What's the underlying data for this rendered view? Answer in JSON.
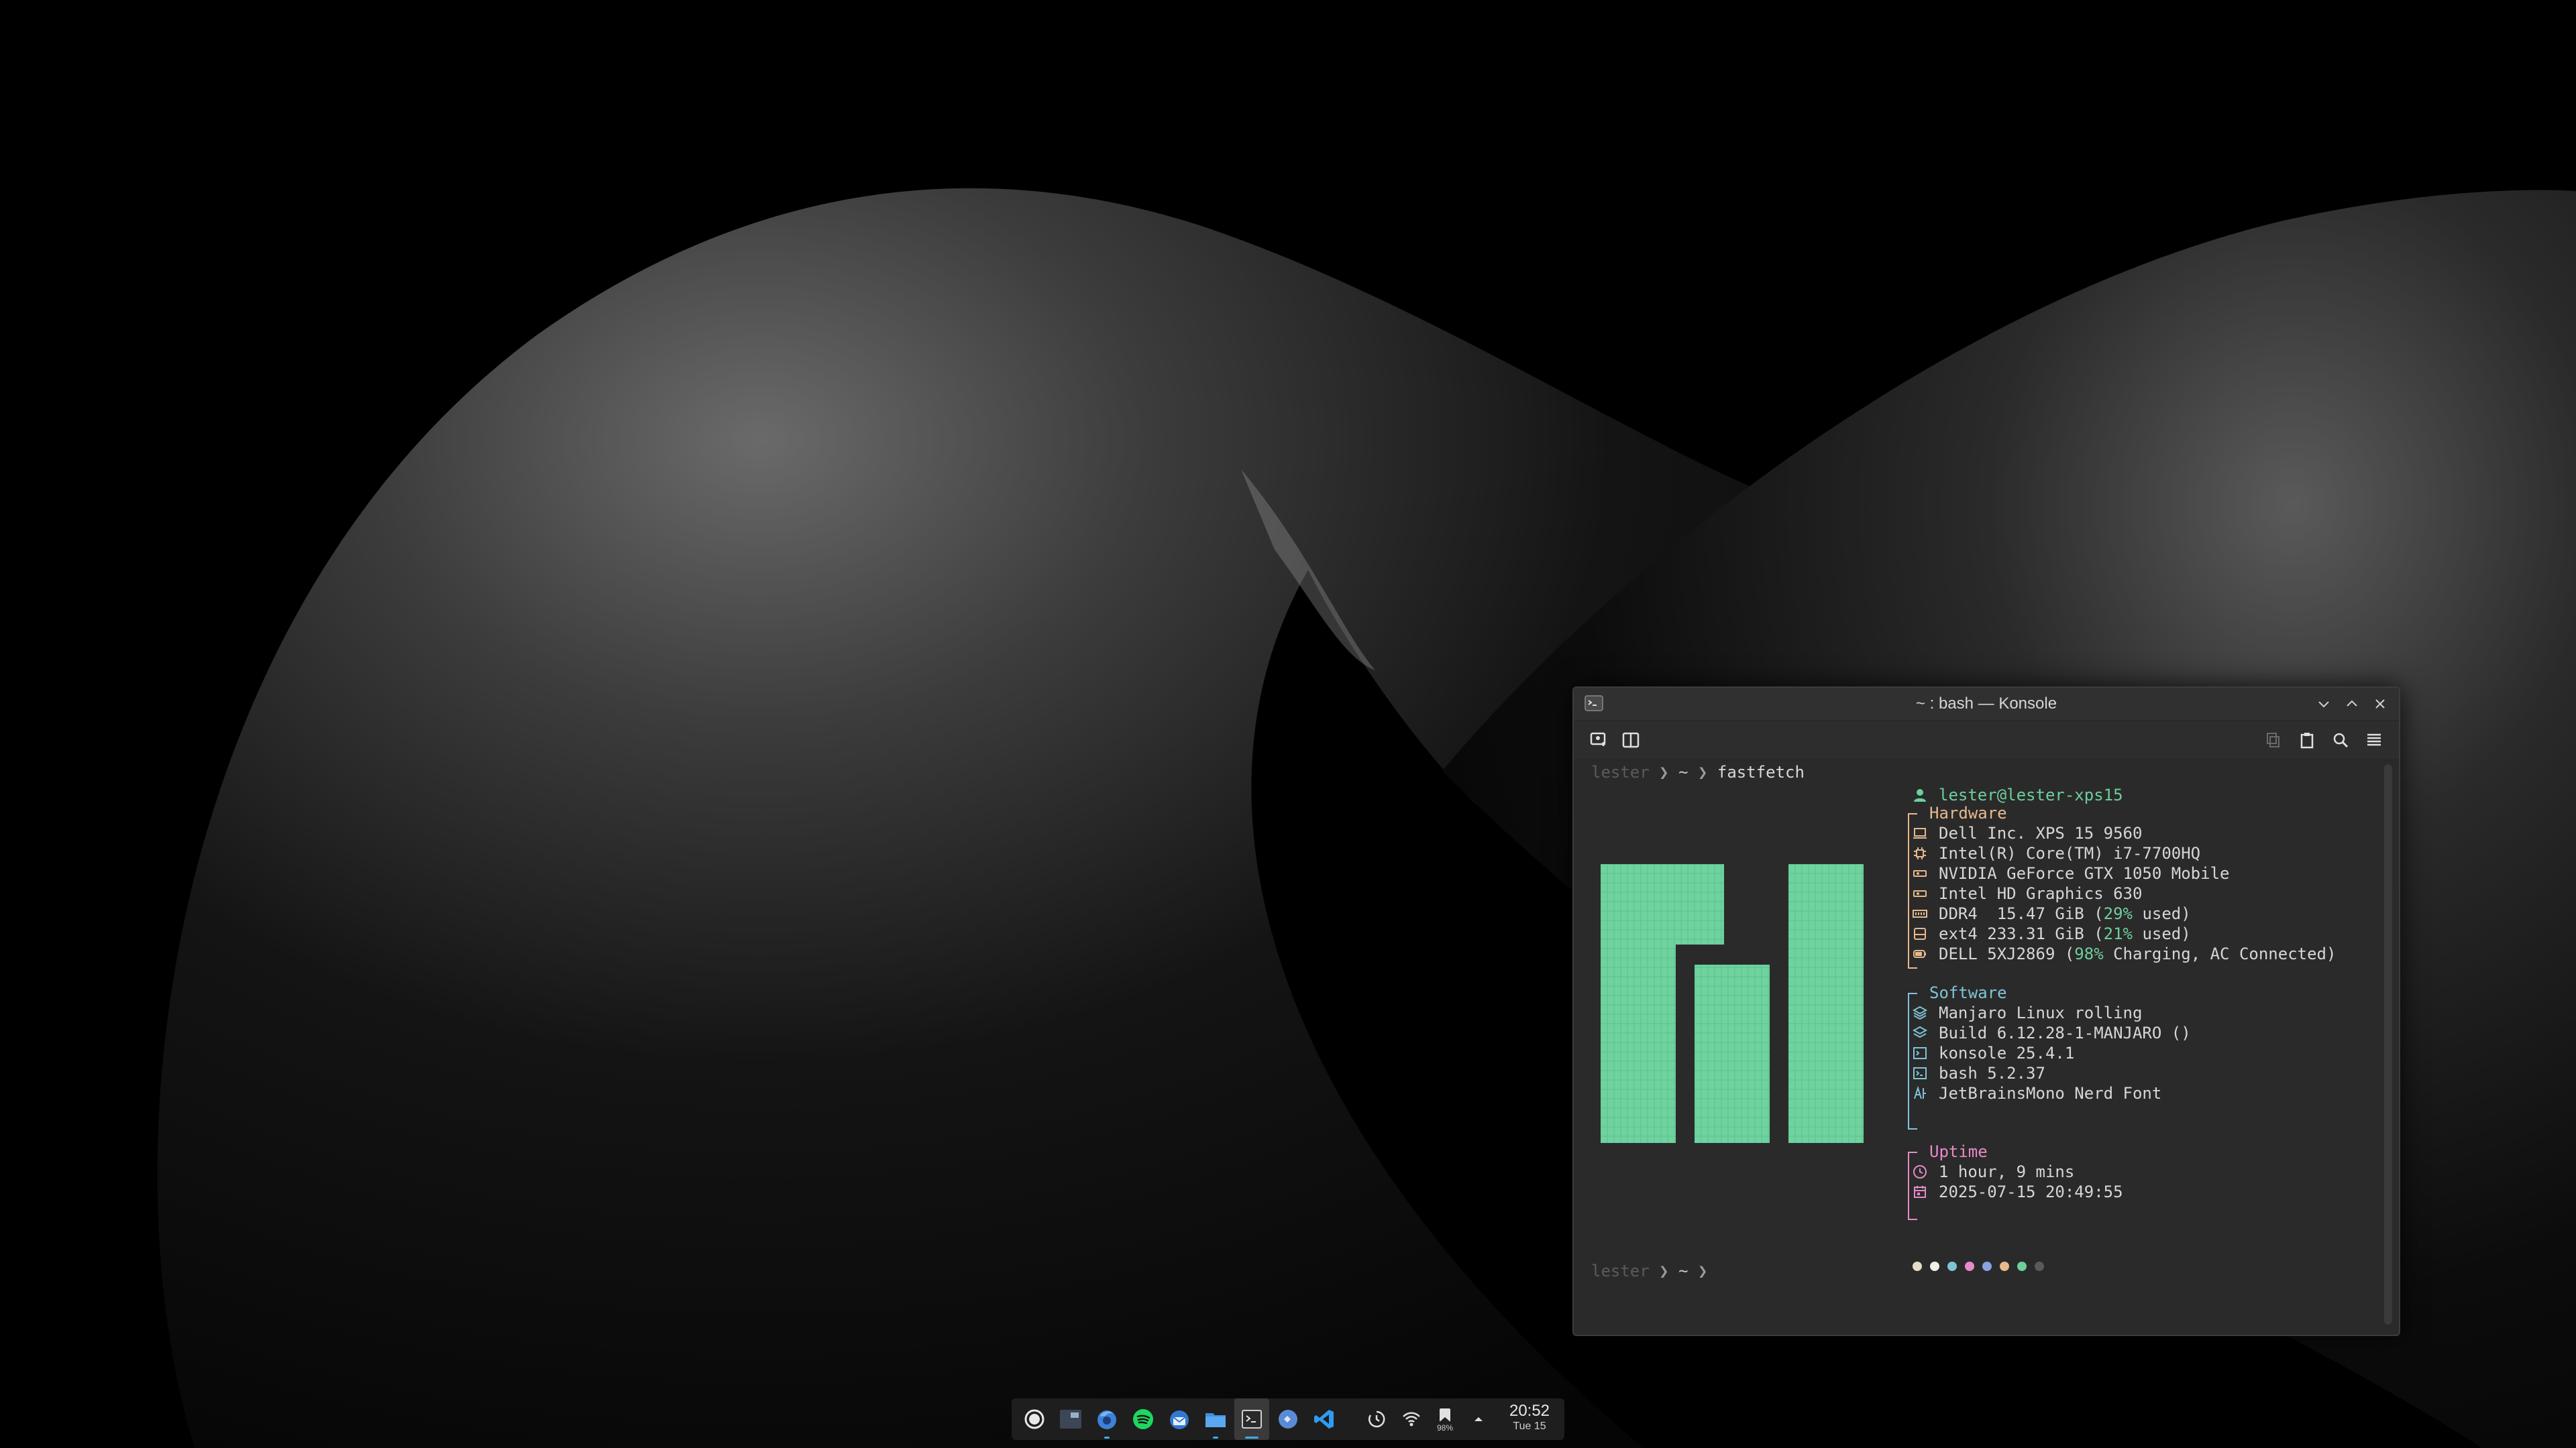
{
  "window": {
    "title": "~ : bash — Konsole"
  },
  "terminal": {
    "prompt1": {
      "user": "lester",
      "path": "~",
      "command": "fastfetch"
    },
    "prompt2": {
      "user": "lester",
      "path": "~"
    },
    "host": "lester@lester-xps15",
    "hardware": {
      "header": "Hardware",
      "lines": [
        {
          "icon": "laptop-icon",
          "text": "Dell Inc. XPS 15 9560"
        },
        {
          "icon": "cpu-icon",
          "text": "Intel(R) Core(TM) i7-7700HQ"
        },
        {
          "icon": "gpu-icon",
          "text": "NVIDIA GeForce GTX 1050 Mobile"
        },
        {
          "icon": "gpu-icon",
          "text": "Intel HD Graphics 630"
        },
        {
          "icon": "memory-icon",
          "pre": "DDR4  15.47 GiB (",
          "pct": "29%",
          "post": " used)"
        },
        {
          "icon": "disk-icon",
          "pre": "ext4 233.31 GiB (",
          "pct": "21%",
          "post": " used)"
        },
        {
          "icon": "battery-icon",
          "pre": "DELL 5XJ2869 (",
          "pct": "98%",
          "post": " Charging, AC Connected)"
        }
      ]
    },
    "software": {
      "header": "Software",
      "lines": [
        {
          "icon": "os-icon",
          "text": "Manjaro Linux rolling"
        },
        {
          "icon": "kernel-icon",
          "text": "Build 6.12.28-1-MANJARO ()"
        },
        {
          "icon": "terminal-icon",
          "text": "konsole 25.4.1"
        },
        {
          "icon": "shell-icon",
          "text": "bash 5.2.37"
        },
        {
          "icon": "font-icon",
          "text": "JetBrainsMono Nerd Font"
        }
      ]
    },
    "uptime": {
      "header": "Uptime",
      "lines": [
        {
          "icon": "clock-icon",
          "text": "1 hour, 9 mins"
        },
        {
          "icon": "calendar-icon",
          "text": "2025-07-15 20:49:55"
        }
      ]
    },
    "palette": [
      "#e8dcc8",
      "#f0f0e8",
      "#7fc4d6",
      "#e68ac8",
      "#8aa2e0",
      "#e7b98d",
      "#6ecf9b",
      "#5a5a5a"
    ],
    "colors": {
      "accent_green": "#6ecf9b",
      "hardware": "#e7b98d",
      "software": "#7fc4d6",
      "uptime": "#e68ac8"
    }
  },
  "taskbar": {
    "apps": [
      {
        "name": "app-launcher-icon"
      },
      {
        "name": "desktop-pager-icon"
      },
      {
        "name": "firefox-icon"
      },
      {
        "name": "spotify-icon"
      },
      {
        "name": "thunderbird-icon"
      },
      {
        "name": "dolphin-files-icon"
      },
      {
        "name": "konsole-icon"
      },
      {
        "name": "discover-icon"
      },
      {
        "name": "vscode-icon"
      }
    ],
    "tray": {
      "battery_percent": "98%",
      "time": "20:52",
      "date": "Tue 15"
    }
  }
}
